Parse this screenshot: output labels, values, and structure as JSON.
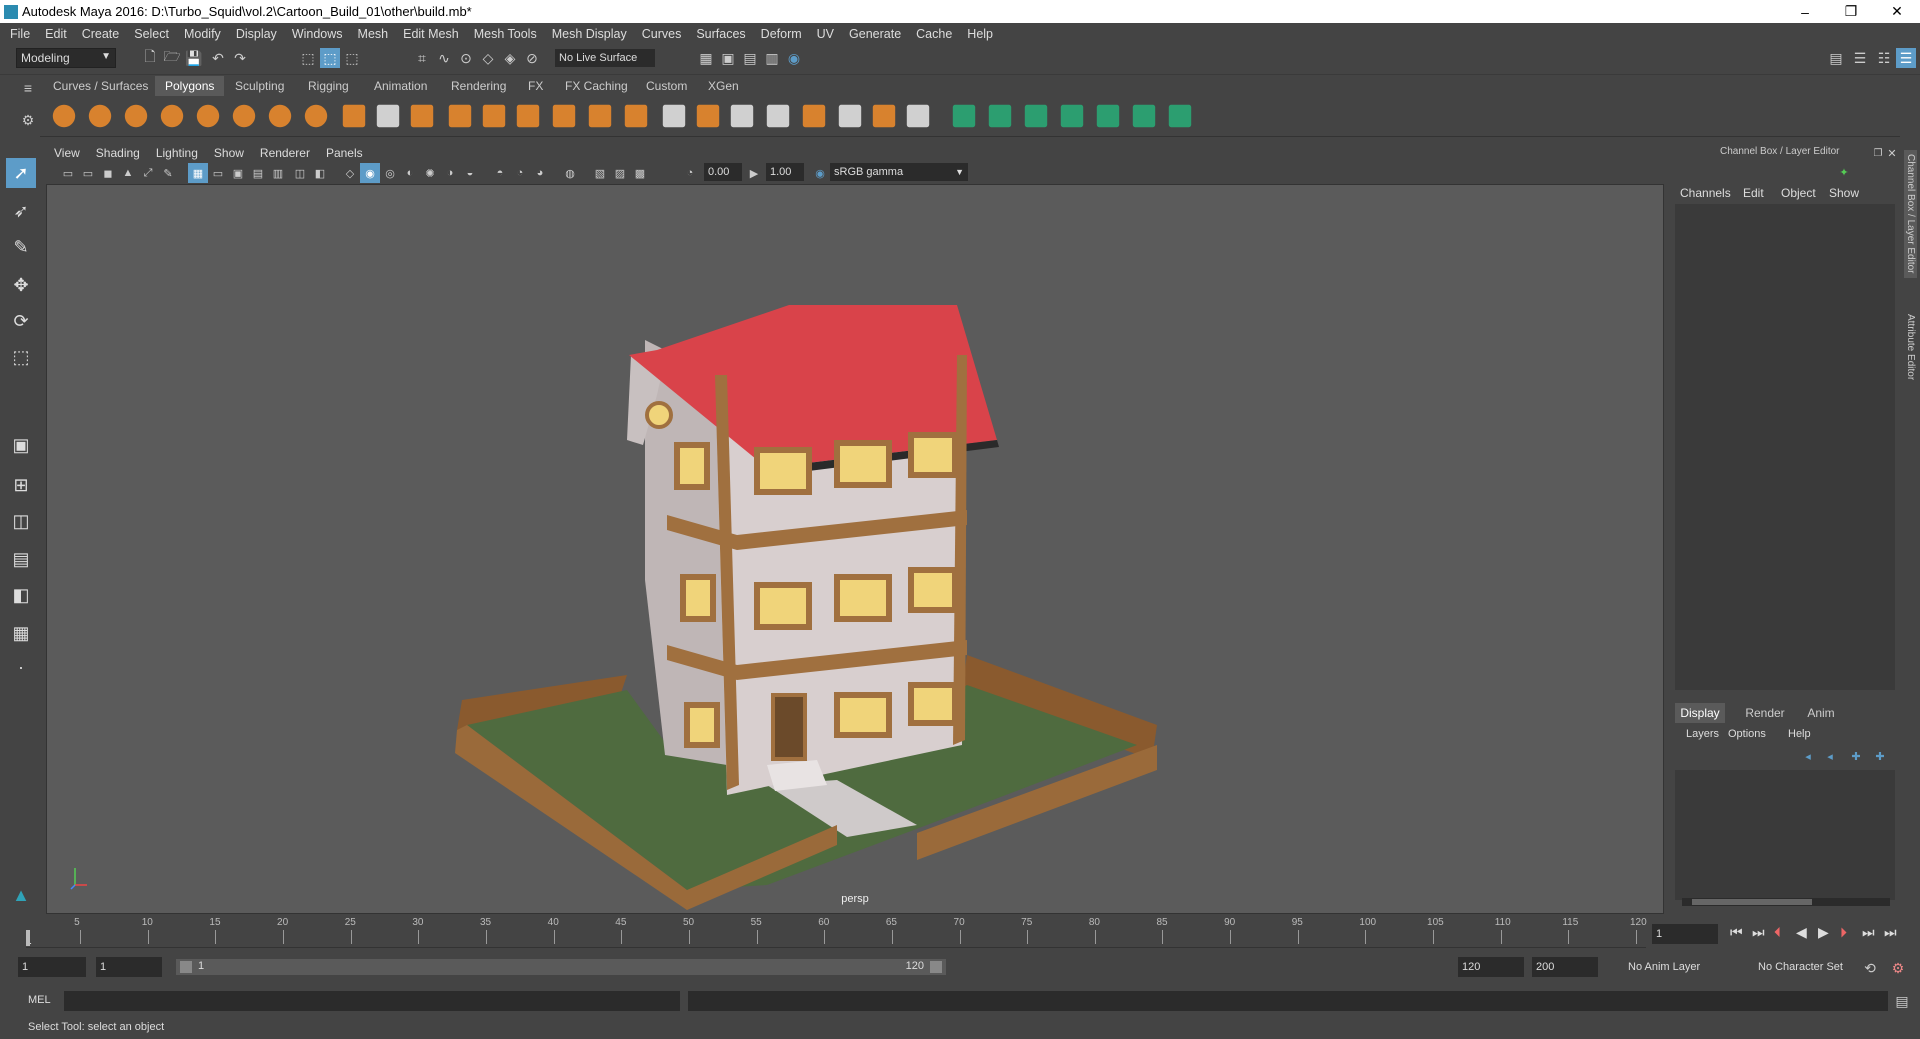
{
  "window": {
    "title": "Autodesk Maya 2016: D:\\Turbo_Squid\\vol.2\\Cartoon_Build_01\\other\\build.mb*",
    "controls": [
      "–",
      "❐",
      "✕"
    ]
  },
  "menubar": [
    "File",
    "Edit",
    "Create",
    "Select",
    "Modify",
    "Display",
    "Windows",
    "Mesh",
    "Edit Mesh",
    "Mesh Tools",
    "Mesh Display",
    "Curves",
    "Surfaces",
    "Deform",
    "UV",
    "Generate",
    "Cache",
    "Help"
  ],
  "statusline": {
    "mode": "Modeling",
    "live_surface": "No Live Surface"
  },
  "shelf": {
    "tabs": [
      "Curves / Surfaces",
      "Polygons",
      "Sculpting",
      "Rigging",
      "Animation",
      "Rendering",
      "FX",
      "FX Caching",
      "Custom",
      "XGen"
    ],
    "active_tab": "Polygons"
  },
  "panel": {
    "menu": [
      "View",
      "Shading",
      "Lighting",
      "Show",
      "Renderer",
      "Panels"
    ],
    "exposure": "0.00",
    "gamma": "1.00",
    "color_space": "sRGB gamma",
    "camera_label": "persp"
  },
  "channel_box": {
    "title": "Channel Box / Layer Editor",
    "menu": [
      "Channels",
      "Edit",
      "Object",
      "Show"
    ],
    "layer_tabs": [
      "Display",
      "Render",
      "Anim"
    ],
    "active_layer_tab": "Display",
    "layer_menu": [
      "Layers",
      "Options",
      "Help"
    ],
    "side_tabs": [
      "Channel Box / Layer Editor",
      "Attribute Editor"
    ]
  },
  "timeline": {
    "ticks": [
      5,
      10,
      15,
      20,
      25,
      30,
      35,
      40,
      45,
      50,
      55,
      60,
      65,
      70,
      75,
      80,
      85,
      90,
      95,
      100,
      105,
      110,
      115,
      120
    ],
    "start_marker": "1",
    "current_frame": "1"
  },
  "range": {
    "start": "1",
    "playback_start": "1",
    "slider_start": "1",
    "slider_end": "120",
    "playback_end": "120",
    "end": "200",
    "anim_layer": "No Anim Layer",
    "character_set": "No Character Set"
  },
  "command": {
    "label": "MEL",
    "value": ""
  },
  "help_line": "Select Tool: select an object",
  "colors": {
    "ui_bg": "#444444",
    "viewport_bg": "#5b5b5b",
    "roof": "#d9434a",
    "wall": "#d8cfcf",
    "wood": "#a0703f",
    "window_glass": "#f0d47a",
    "grass": "#4f6b3f",
    "accent": "#5d9cc8"
  }
}
